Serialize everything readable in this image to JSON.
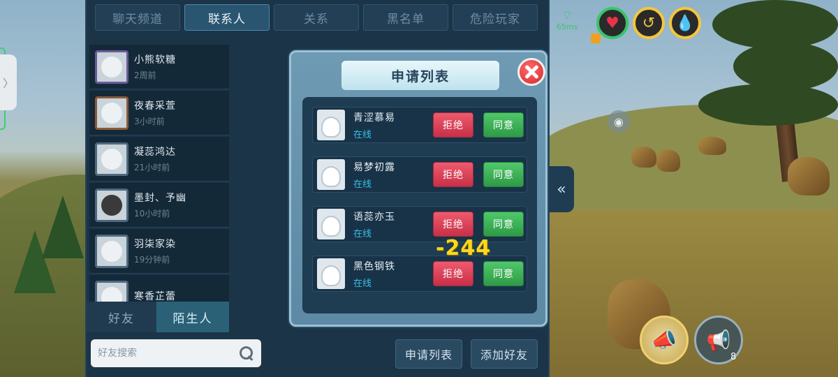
{
  "tabs": [
    "聊天频道",
    "联系人",
    "关系",
    "黑名单",
    "危险玩家"
  ],
  "contacts": [
    {
      "name": "小熊软糖",
      "time": "2周前"
    },
    {
      "name": "夜春采萱",
      "time": "3小时前"
    },
    {
      "name": "凝蕊鸿达",
      "time": "21小时前"
    },
    {
      "name": "墨封、予幽",
      "time": "10小时前"
    },
    {
      "name": "羽柒家染",
      "time": "19分钟前"
    },
    {
      "name": "寒香芷蕾",
      "time": ""
    }
  ],
  "bottom_tabs": {
    "friends": "好友",
    "strangers": "陌生人"
  },
  "search": {
    "placeholder": "好友搜索"
  },
  "footer": {
    "request_list": "申请列表",
    "add_friend": "添加好友"
  },
  "dialog": {
    "title": "申请列表",
    "reject_label": "拒绝",
    "accept_label": "同意",
    "requests": [
      {
        "name": "青涩慕易",
        "status": "在线"
      },
      {
        "name": "易梦初露",
        "status": "在线"
      },
      {
        "name": "语蕊亦玉",
        "status": "在线"
      },
      {
        "name": "黑色钢铁",
        "status": "在线"
      }
    ]
  },
  "floating_number": "-244",
  "hud": {
    "network": "65ms",
    "icons": [
      "heart-icon",
      "stamina-icon",
      "water-drop-icon"
    ],
    "megaphone_count": "8"
  },
  "colors": {
    "panel": "#1b3447",
    "active_tab": "#2a5570",
    "reject": "#d8404f",
    "accept": "#3aa855",
    "online": "#35c0e8"
  }
}
